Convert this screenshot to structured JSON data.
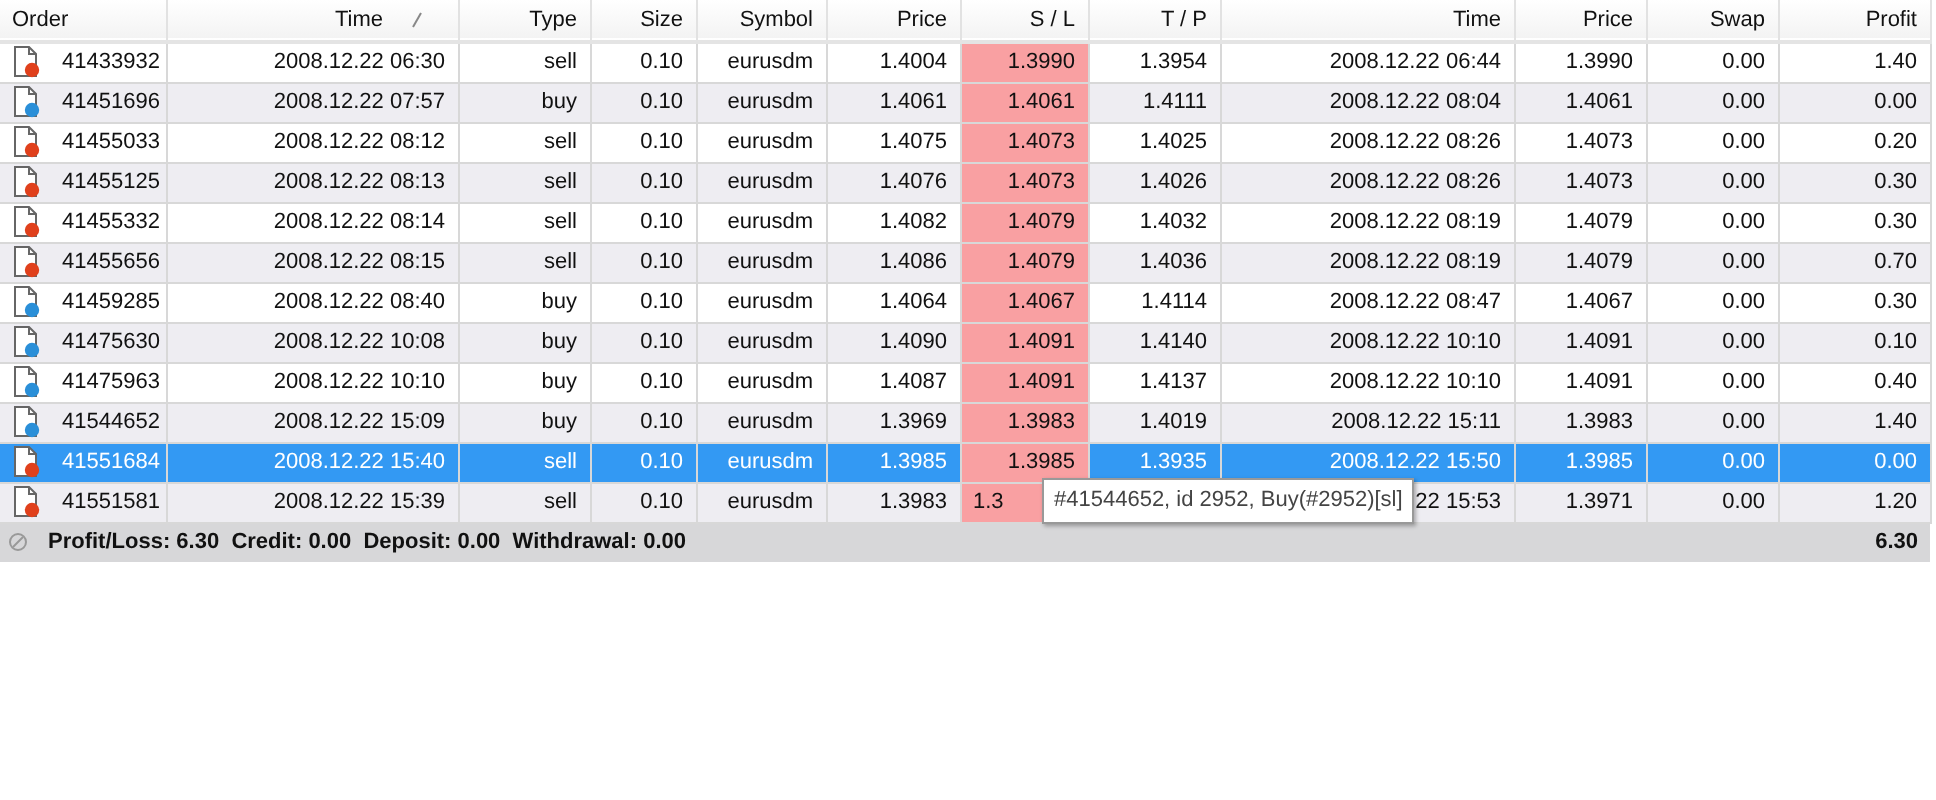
{
  "table": {
    "columns": [
      {
        "label": "Order",
        "sorted": false
      },
      {
        "label": "Time",
        "sorted": true
      },
      {
        "label": "Type",
        "sorted": false
      },
      {
        "label": "Size",
        "sorted": false
      },
      {
        "label": "Symbol",
        "sorted": false
      },
      {
        "label": "Price",
        "sorted": false
      },
      {
        "label": "S / L",
        "sorted": false
      },
      {
        "label": "T / P",
        "sorted": false
      },
      {
        "label": "Time",
        "sorted": false
      },
      {
        "label": "Price",
        "sorted": false
      },
      {
        "label": "Swap",
        "sorted": false
      },
      {
        "label": "Profit",
        "sorted": false
      }
    ],
    "rows": [
      {
        "selected": false,
        "color": "#e0401c",
        "cells": [
          "41433932",
          "2008.12.22 06:30",
          "sell",
          "0.10",
          "eurusdm",
          "1.4004",
          "1.3990",
          "1.3954",
          "2008.12.22 06:44",
          "1.3990",
          "0.00",
          "1.40"
        ]
      },
      {
        "selected": false,
        "color": "#2a8fd8",
        "cells": [
          "41451696",
          "2008.12.22 07:57",
          "buy",
          "0.10",
          "eurusdm",
          "1.4061",
          "1.4061",
          "1.4111",
          "2008.12.22 08:04",
          "1.4061",
          "0.00",
          "0.00"
        ]
      },
      {
        "selected": false,
        "color": "#e0401c",
        "cells": [
          "41455033",
          "2008.12.22 08:12",
          "sell",
          "0.10",
          "eurusdm",
          "1.4075",
          "1.4073",
          "1.4025",
          "2008.12.22 08:26",
          "1.4073",
          "0.00",
          "0.20"
        ]
      },
      {
        "selected": false,
        "color": "#e0401c",
        "cells": [
          "41455125",
          "2008.12.22 08:13",
          "sell",
          "0.10",
          "eurusdm",
          "1.4076",
          "1.4073",
          "1.4026",
          "2008.12.22 08:26",
          "1.4073",
          "0.00",
          "0.30"
        ]
      },
      {
        "selected": false,
        "color": "#e0401c",
        "cells": [
          "41455332",
          "2008.12.22 08:14",
          "sell",
          "0.10",
          "eurusdm",
          "1.4082",
          "1.4079",
          "1.4032",
          "2008.12.22 08:19",
          "1.4079",
          "0.00",
          "0.30"
        ]
      },
      {
        "selected": false,
        "color": "#e0401c",
        "cells": [
          "41455656",
          "2008.12.22 08:15",
          "sell",
          "0.10",
          "eurusdm",
          "1.4086",
          "1.4079",
          "1.4036",
          "2008.12.22 08:19",
          "1.4079",
          "0.00",
          "0.70"
        ]
      },
      {
        "selected": false,
        "color": "#2a8fd8",
        "cells": [
          "41459285",
          "2008.12.22 08:40",
          "buy",
          "0.10",
          "eurusdm",
          "1.4064",
          "1.4067",
          "1.4114",
          "2008.12.22 08:47",
          "1.4067",
          "0.00",
          "0.30"
        ]
      },
      {
        "selected": false,
        "color": "#2a8fd8",
        "cells": [
          "41475630",
          "2008.12.22 10:08",
          "buy",
          "0.10",
          "eurusdm",
          "1.4090",
          "1.4091",
          "1.4140",
          "2008.12.22 10:10",
          "1.4091",
          "0.00",
          "0.10"
        ]
      },
      {
        "selected": false,
        "color": "#2a8fd8",
        "cells": [
          "41475963",
          "2008.12.22 10:10",
          "buy",
          "0.10",
          "eurusdm",
          "1.4087",
          "1.4091",
          "1.4137",
          "2008.12.22 10:10",
          "1.4091",
          "0.00",
          "0.40"
        ]
      },
      {
        "selected": false,
        "color": "#2a8fd8",
        "cells": [
          "41544652",
          "2008.12.22 15:09",
          "buy",
          "0.10",
          "eurusdm",
          "1.3969",
          "1.3983",
          "1.4019",
          "2008.12.22 15:11",
          "1.3983",
          "0.00",
          "1.40"
        ]
      },
      {
        "selected": true,
        "color": "#e0401c",
        "cells": [
          "41551684",
          "2008.12.22 15:40",
          "sell",
          "0.10",
          "eurusdm",
          "1.3985",
          "1.3985",
          "1.3935",
          "2008.12.22 15:50",
          "1.3985",
          "0.00",
          "0.00"
        ]
      },
      {
        "selected": false,
        "color": "#e0401c",
        "cells": [
          "41551581",
          "2008.12.22 15:39",
          "sell",
          "0.10",
          "eurusdm",
          "1.3983",
          "1.3",
          null,
          "22 15:53",
          "1.3971",
          "0.00",
          "1.20"
        ]
      }
    ]
  },
  "summary": {
    "text": "Profit/Loss: 6.30  Credit: 0.00  Deposit: 0.00  Withdrawal: 0.00",
    "total": "6.30"
  },
  "tooltip": {
    "text": "#41544652, id 2952, Buy(#2952)[sl]"
  }
}
